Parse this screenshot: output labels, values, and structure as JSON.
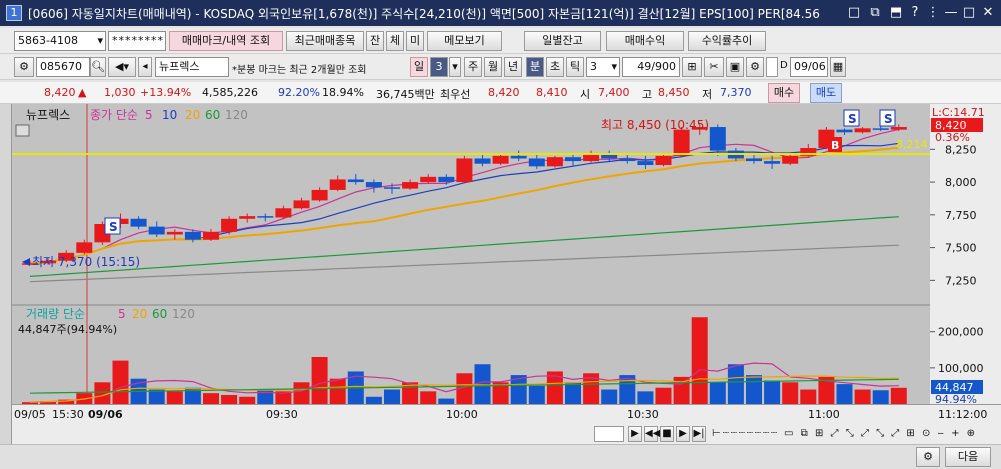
{
  "window": {
    "number": "1",
    "title": "[0606] 자동일지차트(매매내역) - KOSDAQ 외국인보유[1,678(천)] 주식수[24,210(천)] 액면[500] 자본금[121(억)] 결산[12월] EPS[100] PER[84.56",
    "controls": [
      "□",
      "⧉",
      "⬒",
      "?",
      "⋮",
      "—",
      "□",
      "✕"
    ]
  },
  "toolbar1": {
    "account": "5863-4108",
    "password_mask": "********",
    "buttons": [
      "매매마크/내역 조회",
      "최근매매종목",
      "잔",
      "체",
      "미",
      "메모보기",
      "일별잔고",
      "매매수익",
      "수익률추이"
    ]
  },
  "toolbar2": {
    "code": "085670",
    "stock_name": "뉴프렉스",
    "notice": "*분봉 마크는 최근 2개월만 조회",
    "period_buttons": [
      "일",
      "3",
      "주",
      "월",
      "년",
      "분",
      "초",
      "틱"
    ],
    "interval": "3",
    "count": "49",
    "count_total": "/900",
    "date": "09/06"
  },
  "infobar": {
    "price": "8,420",
    "change": "1,030",
    "change_pct": "+13.94%",
    "volume": "4,585,226",
    "ratio1": "92.20%",
    "ratio2": "18.94%",
    "amount": "36,745백만",
    "best_ask_label": "최우선",
    "best_ask": "8,420",
    "best_bid": "8,410",
    "open_label": "시",
    "open": "7,400",
    "high_label": "고",
    "high": "8,450",
    "low_label": "저",
    "low": "7,370",
    "buy_label": "매수",
    "sell_label": "매도"
  },
  "price_panel": {
    "name": "뉴프렉스",
    "legend_main": "종가 단순",
    "ma_periods": [
      "5",
      "10",
      "20",
      "60",
      "120"
    ],
    "high_annotation": "최고 8,450 (10:45)",
    "low_annotation": "최저 7,370 (15:15)",
    "right_label_top": "L:C:14.71",
    "right_price": "8,420",
    "right_pct": "0.36%",
    "line_value": "8,214",
    "y_ticks": [
      "8,250",
      "8,000",
      "7,750",
      "7,500",
      "7,250"
    ],
    "markers": [
      "S",
      "B",
      "S",
      "S"
    ]
  },
  "volume_panel": {
    "legend_main": "거래량 단순",
    "ma_periods": [
      "5",
      "20",
      "60",
      "120"
    ],
    "current": "44,847주(94.94%)",
    "y_ticks": [
      "200,000",
      "100,000"
    ],
    "right_value": "44,847",
    "right_pct": "94.94%"
  },
  "time_axis": {
    "labels": [
      "09/05",
      "15:30",
      "09/06",
      "09:30",
      "10:00",
      "10:30",
      "11:00",
      "11:12:00"
    ]
  },
  "bottom": {
    "next_label": "다음"
  },
  "colors": {
    "up": "#e8191b",
    "down": "#1457cc",
    "ma5": "#cc3399",
    "ma10": "#1f3fbf",
    "ma20": "#f0a400",
    "ma60": "#1a9a3a",
    "ma120": "#888888",
    "chart_bg": "#c2c2c2",
    "line_yellow": "#e8e800"
  },
  "chart_data": {
    "type": "candlestick",
    "price_series": [
      {
        "o": 7380,
        "h": 7400,
        "l": 7370,
        "c": 7380
      },
      {
        "o": 7380,
        "h": 7420,
        "l": 7370,
        "c": 7400
      },
      {
        "o": 7400,
        "h": 7480,
        "l": 7390,
        "c": 7460
      },
      {
        "o": 7460,
        "h": 7560,
        "l": 7450,
        "c": 7540
      },
      {
        "o": 7540,
        "h": 7700,
        "l": 7520,
        "c": 7680
      },
      {
        "o": 7680,
        "h": 7760,
        "l": 7650,
        "c": 7720
      },
      {
        "o": 7720,
        "h": 7740,
        "l": 7640,
        "c": 7660
      },
      {
        "o": 7660,
        "h": 7700,
        "l": 7580,
        "c": 7600
      },
      {
        "o": 7600,
        "h": 7640,
        "l": 7560,
        "c": 7620
      },
      {
        "o": 7620,
        "h": 7640,
        "l": 7540,
        "c": 7560
      },
      {
        "o": 7560,
        "h": 7640,
        "l": 7550,
        "c": 7620
      },
      {
        "o": 7620,
        "h": 7740,
        "l": 7600,
        "c": 7720
      },
      {
        "o": 7720,
        "h": 7760,
        "l": 7690,
        "c": 7740
      },
      {
        "o": 7740,
        "h": 7760,
        "l": 7700,
        "c": 7730
      },
      {
        "o": 7730,
        "h": 7820,
        "l": 7720,
        "c": 7800
      },
      {
        "o": 7800,
        "h": 7880,
        "l": 7790,
        "c": 7860
      },
      {
        "o": 7860,
        "h": 7960,
        "l": 7850,
        "c": 7940
      },
      {
        "o": 7940,
        "h": 8050,
        "l": 7930,
        "c": 8020
      },
      {
        "o": 8020,
        "h": 8060,
        "l": 7980,
        "c": 8000
      },
      {
        "o": 8000,
        "h": 8020,
        "l": 7920,
        "c": 7960
      },
      {
        "o": 7960,
        "h": 7990,
        "l": 7910,
        "c": 7950
      },
      {
        "o": 7950,
        "h": 8020,
        "l": 7940,
        "c": 8000
      },
      {
        "o": 8000,
        "h": 8060,
        "l": 7990,
        "c": 8040
      },
      {
        "o": 8040,
        "h": 8060,
        "l": 7980,
        "c": 8000
      },
      {
        "o": 8000,
        "h": 8200,
        "l": 7990,
        "c": 8180
      },
      {
        "o": 8180,
        "h": 8220,
        "l": 8120,
        "c": 8140
      },
      {
        "o": 8140,
        "h": 8220,
        "l": 8130,
        "c": 8200
      },
      {
        "o": 8200,
        "h": 8240,
        "l": 8160,
        "c": 8180
      },
      {
        "o": 8180,
        "h": 8220,
        "l": 8100,
        "c": 8120
      },
      {
        "o": 8120,
        "h": 8200,
        "l": 8110,
        "c": 8190
      },
      {
        "o": 8190,
        "h": 8220,
        "l": 8120,
        "c": 8160
      },
      {
        "o": 8160,
        "h": 8240,
        "l": 8150,
        "c": 8220
      },
      {
        "o": 8220,
        "h": 8240,
        "l": 8160,
        "c": 8180
      },
      {
        "o": 8180,
        "h": 8220,
        "l": 8140,
        "c": 8160
      },
      {
        "o": 8160,
        "h": 8200,
        "l": 8100,
        "c": 8130
      },
      {
        "o": 8130,
        "h": 8220,
        "l": 8120,
        "c": 8200
      },
      {
        "o": 8200,
        "h": 8420,
        "l": 8190,
        "c": 8400
      },
      {
        "o": 8400,
        "h": 8450,
        "l": 8360,
        "c": 8420
      },
      {
        "o": 8420,
        "h": 8440,
        "l": 8200,
        "c": 8240
      },
      {
        "o": 8240,
        "h": 8260,
        "l": 8160,
        "c": 8180
      },
      {
        "o": 8180,
        "h": 8220,
        "l": 8140,
        "c": 8160
      },
      {
        "o": 8160,
        "h": 8200,
        "l": 8100,
        "c": 8140
      },
      {
        "o": 8140,
        "h": 8220,
        "l": 8130,
        "c": 8200
      },
      {
        "o": 8200,
        "h": 8290,
        "l": 8190,
        "c": 8260
      },
      {
        "o": 8260,
        "h": 8420,
        "l": 8250,
        "c": 8400
      },
      {
        "o": 8400,
        "h": 8410,
        "l": 8360,
        "c": 8380
      },
      {
        "o": 8380,
        "h": 8420,
        "l": 8370,
        "c": 8410
      },
      {
        "o": 8410,
        "h": 8430,
        "l": 8390,
        "c": 8400
      },
      {
        "o": 8400,
        "h": 8440,
        "l": 8390,
        "c": 8420
      }
    ],
    "volume_series": [
      5000,
      8000,
      12000,
      30000,
      60000,
      120000,
      70000,
      40000,
      35000,
      45000,
      30000,
      25000,
      20000,
      40000,
      35000,
      60000,
      130000,
      70000,
      90000,
      20000,
      40000,
      60000,
      35000,
      15000,
      85000,
      110000,
      60000,
      80000,
      50000,
      90000,
      60000,
      85000,
      40000,
      80000,
      35000,
      45000,
      75000,
      240000,
      60000,
      110000,
      80000,
      65000,
      60000,
      40000,
      75000,
      55000,
      40000,
      38000,
      44847
    ],
    "ylim": [
      7100,
      8550
    ],
    "vol_ylim": [
      0,
      260000
    ]
  }
}
